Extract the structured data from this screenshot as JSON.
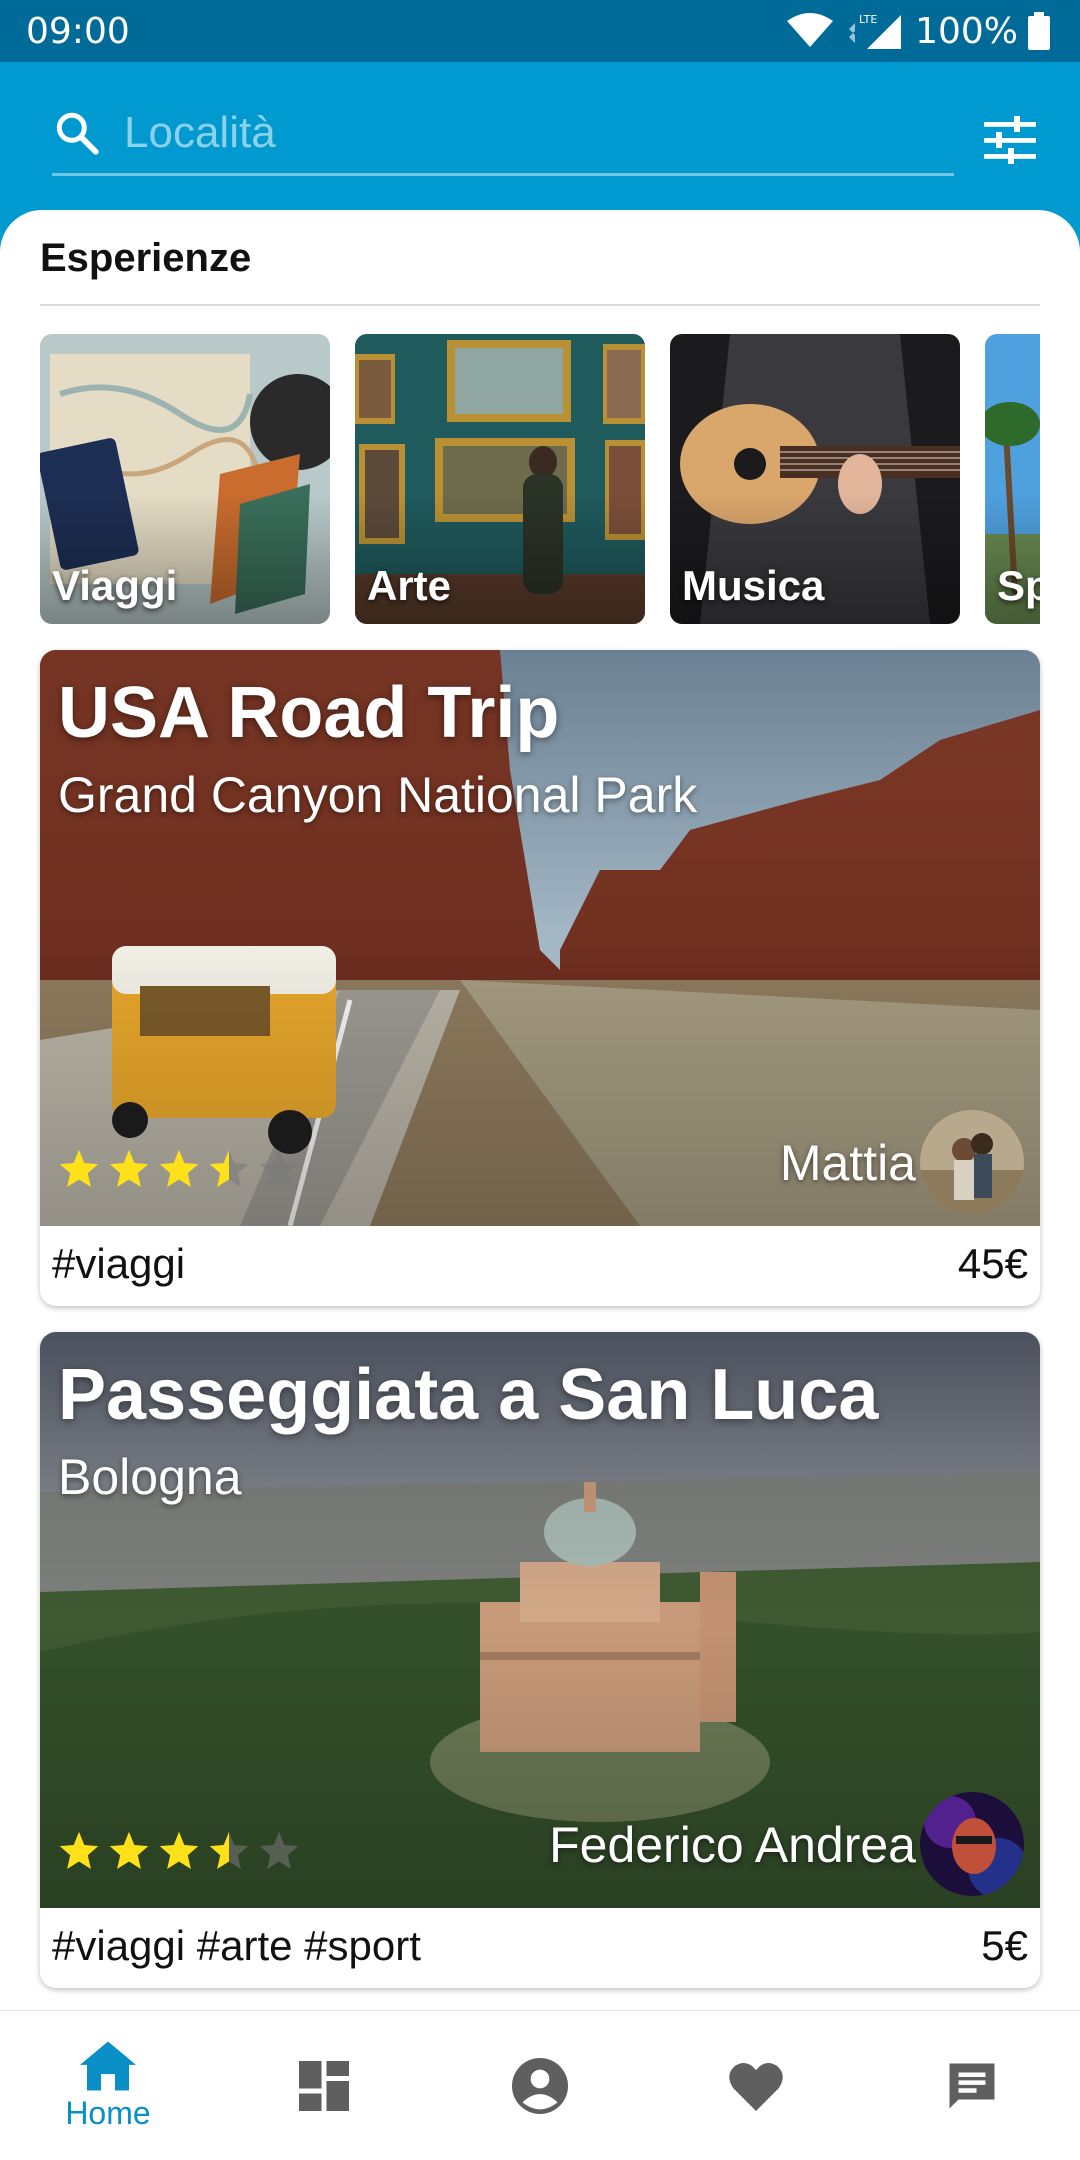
{
  "status": {
    "time": "09:00",
    "network": "LTE",
    "battery": "100%"
  },
  "search": {
    "placeholder": "Località",
    "value": ""
  },
  "section": {
    "title": "Esperienze"
  },
  "categories": [
    {
      "label": "Viaggi"
    },
    {
      "label": "Arte"
    },
    {
      "label": "Musica"
    },
    {
      "label": "Sp"
    }
  ],
  "experiences": [
    {
      "title": "USA Road Trip",
      "subtitle": "Grand Canyon National Park",
      "rating": 3.5,
      "host": "Mattia",
      "tags": "#viaggi",
      "price": "45€"
    },
    {
      "title": "Passeggiata a San Luca",
      "subtitle": "Bologna",
      "rating": 3.5,
      "host": "Federico Andrea",
      "tags": "#viaggi #arte #sport",
      "price": "5€"
    }
  ],
  "nav": {
    "home_label": "Home",
    "active": "home"
  },
  "colors": {
    "primary": "#0099d0",
    "statusbar": "#006a99",
    "star": "#ffe11a",
    "nav_active": "#0a8fc6",
    "nav_inactive": "#5f5f5f"
  }
}
